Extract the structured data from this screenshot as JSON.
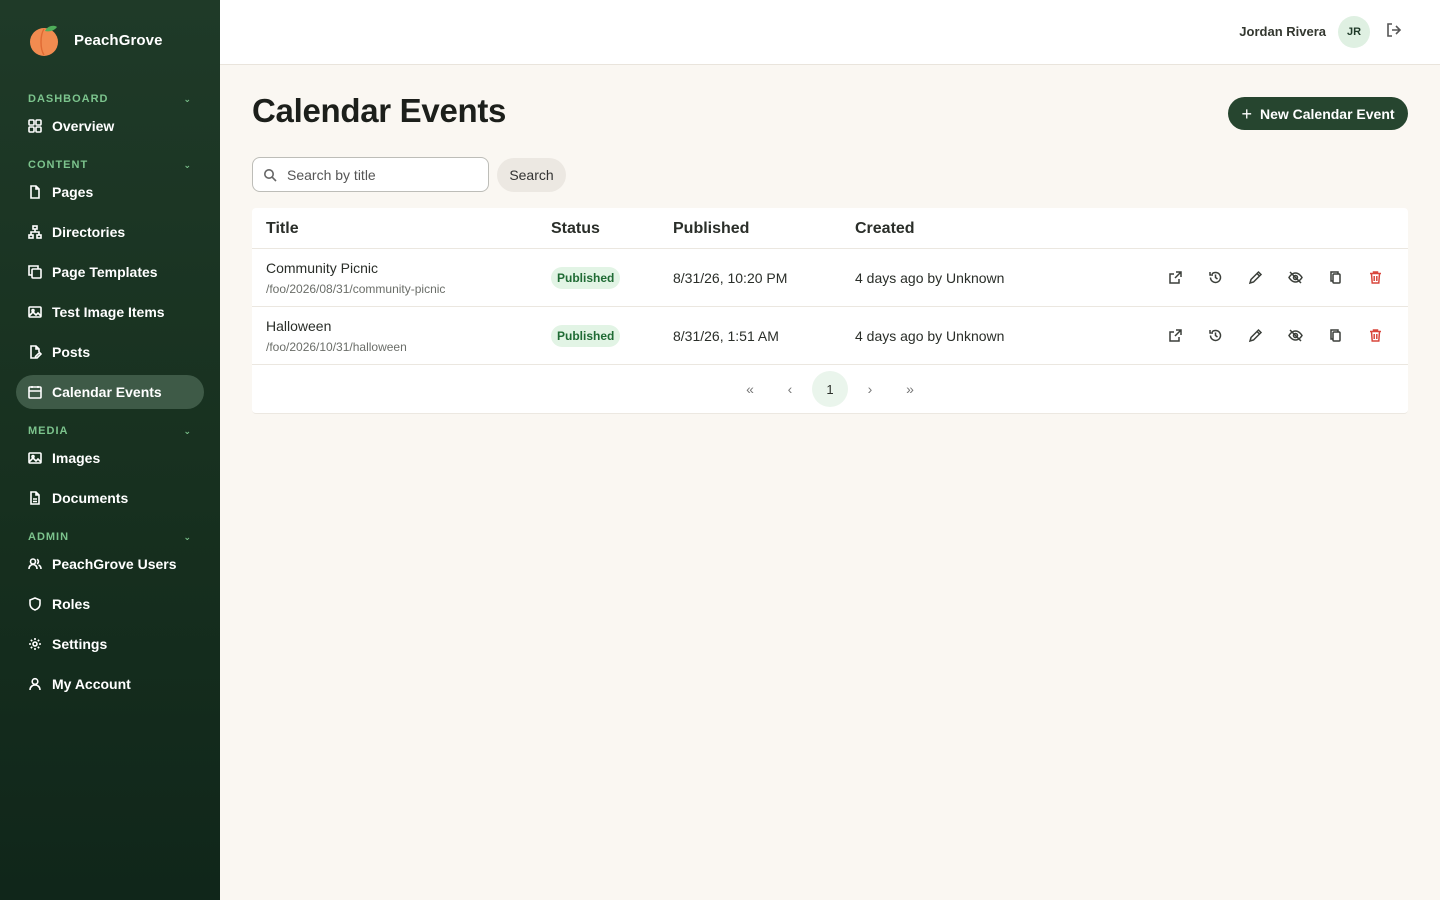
{
  "brand": {
    "name": "PeachGrove"
  },
  "sidebar": {
    "sections": [
      {
        "label": "DASHBOARD"
      },
      {
        "label": "CONTENT"
      },
      {
        "label": "MEDIA"
      },
      {
        "label": "ADMIN"
      }
    ],
    "items": [
      {
        "label": "Overview",
        "icon": "grid-icon"
      },
      {
        "label": "Pages",
        "icon": "file-icon"
      },
      {
        "label": "Directories",
        "icon": "sitemap-icon"
      },
      {
        "label": "Page Templates",
        "icon": "copy-icon"
      },
      {
        "label": "Test Image Items",
        "icon": "image-icon"
      },
      {
        "label": "Posts",
        "icon": "file-edit-icon"
      },
      {
        "label": "Calendar Events",
        "icon": "calendar-icon",
        "active": true
      },
      {
        "label": "Images",
        "icon": "image-icon"
      },
      {
        "label": "Documents",
        "icon": "document-icon"
      },
      {
        "label": "PeachGrove Users",
        "icon": "users-icon"
      },
      {
        "label": "Roles",
        "icon": "shield-icon"
      },
      {
        "label": "Settings",
        "icon": "gear-icon"
      },
      {
        "label": "My Account",
        "icon": "user-icon"
      }
    ]
  },
  "header": {
    "user_name": "Jordan Rivera",
    "initials": "JR"
  },
  "main": {
    "title": "Calendar Events",
    "new_button": "New Calendar Event",
    "search_placeholder": "Search by title",
    "search_button": "Search",
    "columns": [
      "Title",
      "Status",
      "Published",
      "Created"
    ],
    "rows": [
      {
        "title": "Community Picnic",
        "path": "/foo/2026/08/31/community-picnic",
        "status": "Published",
        "published": "8/31/26, 10:20 PM",
        "created": "4 days ago by Unknown"
      },
      {
        "title": "Halloween",
        "path": "/foo/2026/10/31/halloween",
        "status": "Published",
        "published": "8/31/26, 1:51 AM",
        "created": "4 days ago by Unknown"
      }
    ],
    "pagination": {
      "first": "«",
      "prev": "‹",
      "current": "1",
      "next": "›",
      "last": "»"
    }
  },
  "colors": {
    "sidebar": "#1f3a28",
    "accent": "#26452f",
    "badge_bg": "#e2f4e5",
    "badge_text": "#1f6b34",
    "danger": "#d9463c"
  }
}
